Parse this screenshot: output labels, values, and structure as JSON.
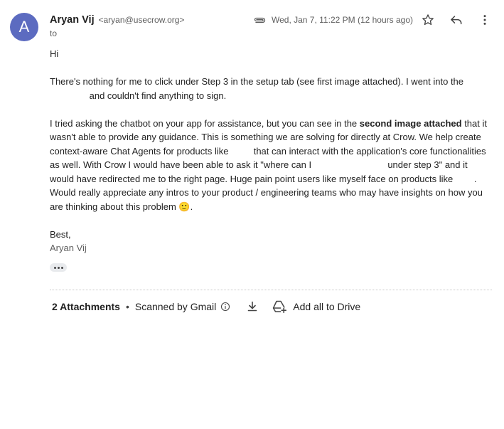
{
  "sender": {
    "avatar_letter": "A",
    "name": "Aryan Vij",
    "email": "<aryan@usecrow.org>",
    "to_label": "to"
  },
  "meta": {
    "date": "Wed, Jan 7, 11:22 PM (12 hours ago)"
  },
  "body": {
    "greeting": "Hi",
    "p1a": "There's nothing for me to click under Step 3 in the setup tab (see first image attached). I went into the",
    "p1b": "and couldn't find anything to sign.",
    "p2a": "I tried asking the chatbot on your app for assistance, but you can see in the",
    "p2bold": "second image attached",
    "p2b": "that it wasn't able to provide any guidance. This is something we are solving for directly at Crow. We help create context-aware Chat Agents for products like",
    "p2c": "that can interact with the application's core functionalities as well. With Crow I would have been able to ask it \"where can I",
    "p2d": "under step 3\" and it would have redirected me to the right page. Huge pain point users like myself face on products like",
    "p2e": ". Would really appreciate any intros to your product / engineering teams who may have insights on how you are thinking about this problem",
    "emoji": "🙂",
    "p2end": ".",
    "signoff": "Best,",
    "signature": "Aryan Vij"
  },
  "attachments": {
    "count_label": "2 Attachments",
    "separator": "•",
    "scanned_label": "Scanned by Gmail",
    "add_drive_label": "Add all to Drive"
  },
  "icons": [
    "attachment-icon",
    "star-icon",
    "reply-icon",
    "more-vert-icon",
    "info-icon",
    "download-icon",
    "add-to-drive-icon"
  ]
}
